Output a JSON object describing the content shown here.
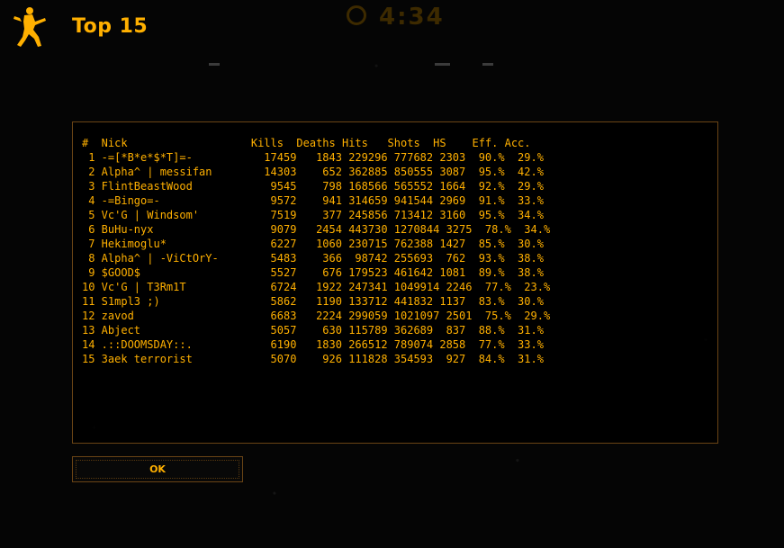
{
  "header": {
    "title": "Top 15",
    "timer": "4:34",
    "logo_icon": "counter-strike-logo-icon",
    "timer_icon": "clock-icon"
  },
  "colors": {
    "accent": "#ffb000",
    "border": "#6a4415",
    "background": "#050505"
  },
  "motd": {
    "header": "#  Nick                   Kills  Deaths Hits   Shots  HS    Eff. Acc.",
    "rows": [
      " 1 -=[*B*e*$*T]=-           17459   1843 229296 777682 2303  90.%  29.%",
      " 2 Alpha^ | messifan        14303    652 362885 850555 3087  95.%  42.%",
      " 3 FlintBeastWood            9545    798 168566 565552 1664  92.%  29.%",
      " 4 -=Bingo=-                 9572    941 314659 941544 2969  91.%  33.%",
      " 5 Vc'G | Windsom'           7519    377 245856 713412 3160  95.%  34.%",
      " 6 BuHu-nyx                  9079   2454 443730 1270844 3275  78.%  34.%",
      " 7 Hekimoglu*                6227   1060 230715 762388 1427  85.%  30.%",
      " 8 Alpha^ | -ViCtOrY-        5483    366  98742 255693  762  93.%  38.%",
      " 9 $GOOD$                    5527    676 179523 461642 1081  89.%  38.%",
      "10 Vc'G | T3Rm1T             6724   1922 247341 1049914 2246  77.%  23.%",
      "11 S1mpl3 ;)                 5862   1190 133712 441832 1137  83.%  30.%",
      "12 zavod                     6683   2224 299059 1021097 2501  75.%  29.%",
      "13 Abject                    5057    630 115789 362689  837  88.%  31.%",
      "14 .::DOOMSDAY::.            6190   1830 266512 789074 2858  77.%  33.%",
      "15 3aek terrorist            5070    926 111828 354593  927  84.%  31.%"
    ]
  },
  "footer": {
    "ok_label": "OK"
  }
}
